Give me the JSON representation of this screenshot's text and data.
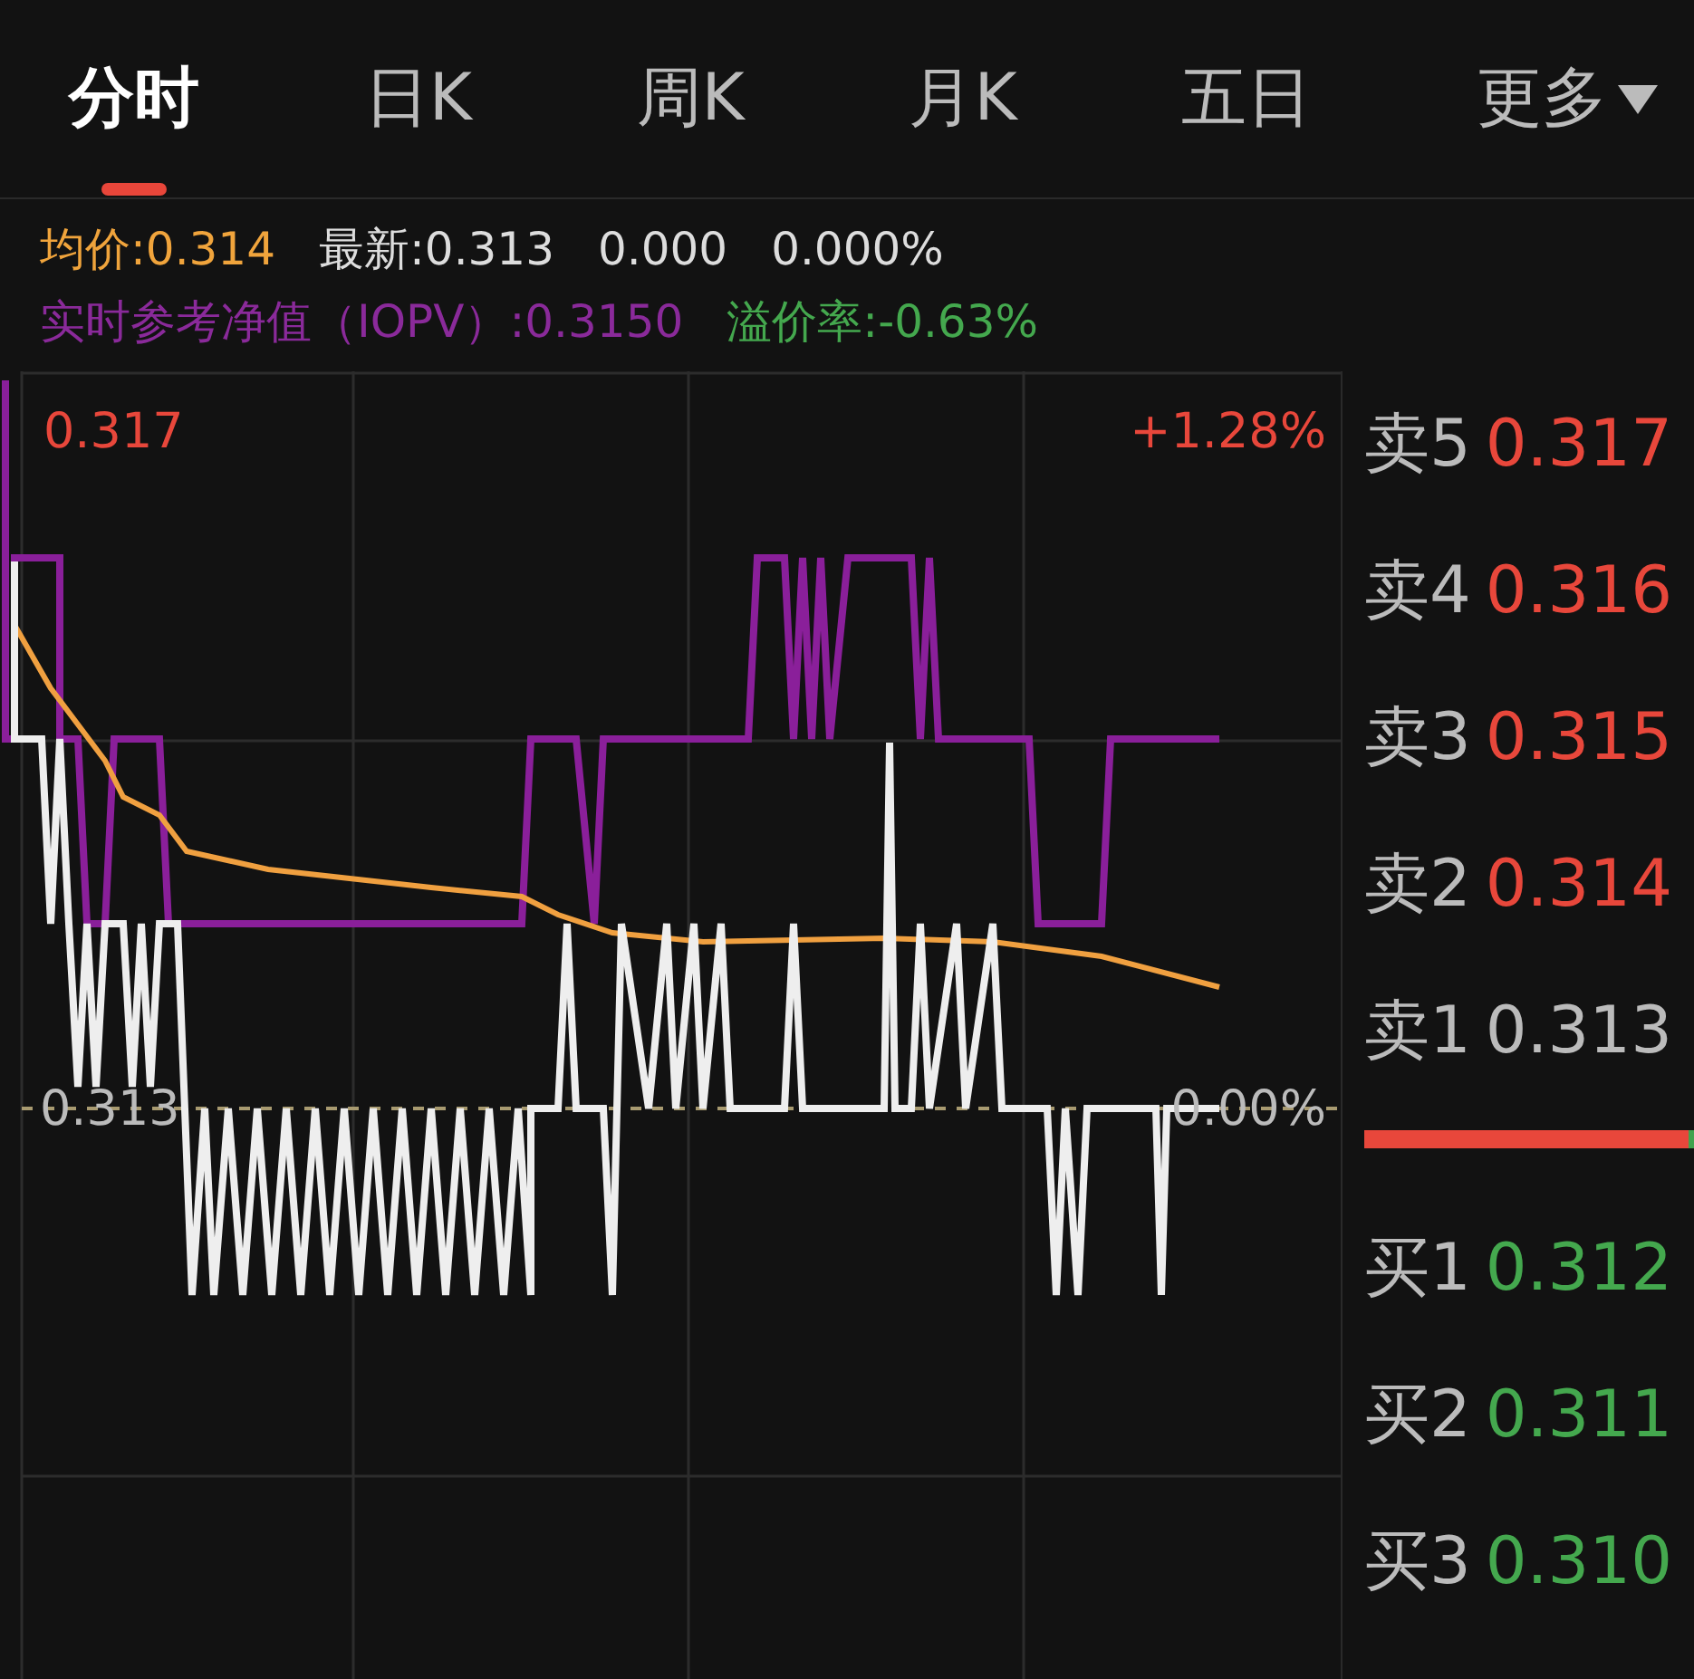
{
  "tabs": [
    {
      "label": "分时",
      "selected": true,
      "has_menu": false
    },
    {
      "label": "日K",
      "selected": false,
      "has_menu": false
    },
    {
      "label": "周K",
      "selected": false,
      "has_menu": false
    },
    {
      "label": "月K",
      "selected": false,
      "has_menu": false
    },
    {
      "label": "五日",
      "selected": false,
      "has_menu": false
    },
    {
      "label": "更多",
      "selected": false,
      "has_menu": true
    }
  ],
  "quote": {
    "avg_price": "均价:0.314",
    "latest": "最新:0.313",
    "change": "0.000",
    "change_pct": "0.000%",
    "iopv": "实时参考净值（IOPV）:0.3150",
    "premium": "溢价率:-0.63%"
  },
  "chart": {
    "top_price": "0.317",
    "top_pct": "+1.28%",
    "base_price": "0.313",
    "base_pct": "0.00%"
  },
  "order_book": {
    "asks": [
      {
        "label": "卖5",
        "price": "0.317",
        "color": "#e8473b"
      },
      {
        "label": "卖4",
        "price": "0.316",
        "color": "#e8473b"
      },
      {
        "label": "卖3",
        "price": "0.315",
        "color": "#e8473b"
      },
      {
        "label": "卖2",
        "price": "0.314",
        "color": "#e8473b"
      },
      {
        "label": "卖1",
        "price": "0.313",
        "color": "#bbbbbb"
      }
    ],
    "ratio": {
      "level": 0.985
    },
    "bids": [
      {
        "label": "买1",
        "price": "0.312",
        "color": "#44a84e"
      },
      {
        "label": "买2",
        "price": "0.311",
        "color": "#44a84e"
      },
      {
        "label": "买3",
        "price": "0.310",
        "color": "#44a84e"
      }
    ]
  }
}
